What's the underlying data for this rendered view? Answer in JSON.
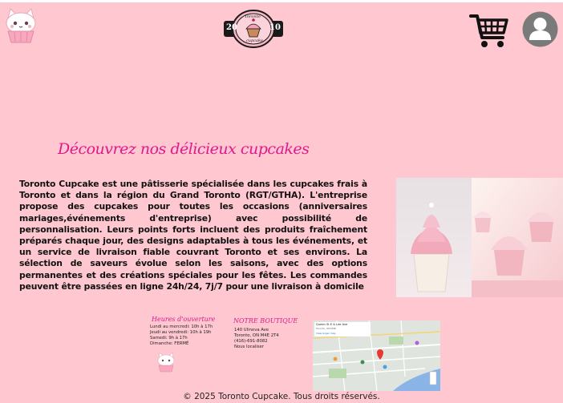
{
  "header": {
    "brand_logo_text_top": "Toronto",
    "brand_logo_text_bottom": "cupcake",
    "brand_logo_left": "20",
    "brand_logo_right": "10",
    "cart_icon": "shopping-cart-icon",
    "user_icon": "user-account-icon"
  },
  "main": {
    "title": "Découvrez nos délicieux cupcakes",
    "description": "Toronto Cupcake est une pâtisserie spécialisée dans les cupcakes frais à Toronto et dans la région du Grand Toronto (RGT/GTHA). L'entreprise propose des cupcakes pour toutes les occasions (anniversaires mariages,événements d'entreprise) avec possibilité de personnalisation. Leurs points forts incluent des produits fraîchement préparés chaque jour, des designs adaptables à tous les événements, et un service de livraison fiable couvrant Toronto et ses environs. La sélection de saveurs évolue selon les saisons, avec des options permanentes et des créations spéciales pour les fêtes. Les commandes peuvent être passées en ligne 24h/24, 7j/7 pour une livraison à domicile"
  },
  "footer": {
    "hours_title": "Heures d'ouverture",
    "hours": [
      "Lundi au mercredi: 10h à 17h",
      "Jeudi au vendredi: 10h à 19h",
      "Samedi: 9h à 17h",
      "Dimanche: FERMÉ"
    ],
    "shop_title": "NOTRE BOUTIQUE",
    "shop": [
      "140 Ulineva Ave",
      "Toronto, ON M4E 2T4",
      "(416)-691-8082",
      "Nous localiser"
    ],
    "map_header": "Queen St E & Lee Ave",
    "map_sub": "Toronto, ON M4E",
    "map_link": "View larger map",
    "copyright": "© 2025 Toronto Cupcake. Tous droits réservés."
  },
  "colors": {
    "page_bg": "#ffc8d0",
    "accent_pink": "#e0188c",
    "text": "#111111"
  }
}
